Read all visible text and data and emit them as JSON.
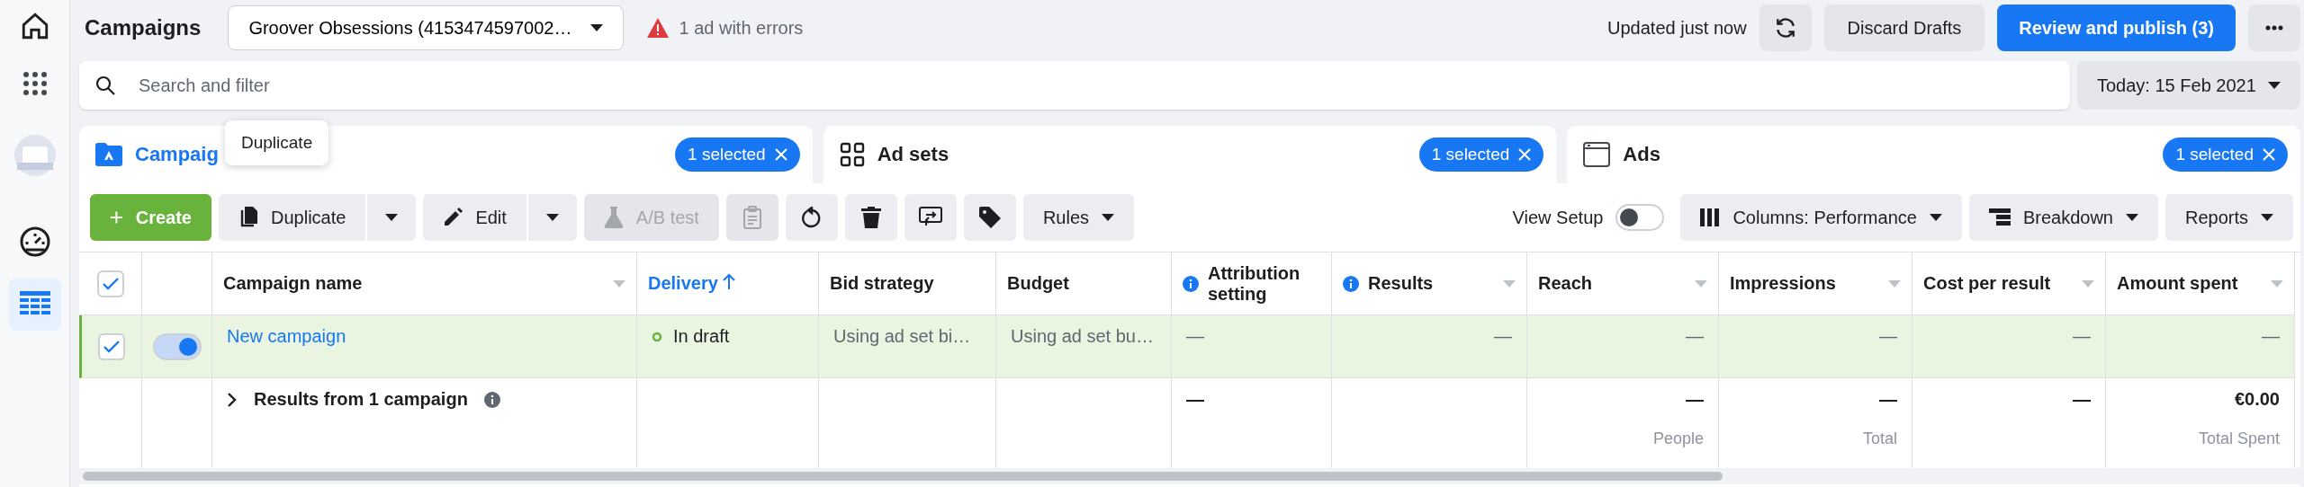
{
  "sidebar": {
    "items": [
      {
        "kind": "home",
        "selected": false
      },
      {
        "kind": "apps",
        "selected": false
      },
      {
        "kind": "avatar",
        "selected": false
      },
      {
        "kind": "gauge",
        "selected": false
      },
      {
        "kind": "table",
        "selected": true
      }
    ]
  },
  "header": {
    "title": "Campaigns",
    "account": "Groover Obsessions (4153474597002…",
    "warning": "1 ad with errors",
    "updated": "Updated just now",
    "discard": "Discard Drafts",
    "publish": "Review and publish (3)"
  },
  "search": {
    "placeholder": "Search and filter"
  },
  "date": "Today: 15 Feb 2021",
  "tabs": [
    {
      "kind": "campaigns",
      "label": "Campaig",
      "selected": true,
      "badge": "1 selected"
    },
    {
      "kind": "adsets",
      "label": "Ad sets",
      "selected": false,
      "badge": "1 selected"
    },
    {
      "kind": "ads",
      "label": "Ads",
      "selected": false,
      "badge": "1 selected"
    }
  ],
  "tooltip": "Duplicate",
  "toolbar": {
    "items": [
      {
        "kind": "create",
        "label": "Create",
        "disabled": false
      },
      {
        "kind": "split",
        "label": "Duplicate",
        "disabled": false
      },
      {
        "kind": "split",
        "label": "Edit",
        "disabled": false
      },
      {
        "kind": "button",
        "label": "A/B test",
        "disabled": true
      },
      {
        "kind": "icon",
        "disabled": true
      },
      {
        "kind": "icon",
        "disabled": false
      },
      {
        "kind": "icon",
        "disabled": false
      },
      {
        "kind": "icon",
        "disabled": false
      },
      {
        "kind": "icon",
        "disabled": false
      },
      {
        "kind": "menu",
        "label": "Rules",
        "disabled": false
      }
    ],
    "right": [
      {
        "kind": "toggle",
        "label": "View Setup",
        "on": false
      },
      {
        "kind": "menu",
        "label": "Columns: Performance"
      },
      {
        "kind": "menu",
        "label": "Breakdown"
      },
      {
        "kind": "menu",
        "label": "Reports"
      }
    ]
  },
  "table": {
    "all_checked": true,
    "columns": [
      {
        "label": "Campaign name",
        "kind": "text",
        "info": false,
        "sorted": false,
        "menu": true
      },
      {
        "label": "Delivery",
        "kind": "text",
        "info": false,
        "sorted": true,
        "menu": false
      },
      {
        "label": "Bid strategy",
        "kind": "text",
        "info": false,
        "sorted": false,
        "menu": false
      },
      {
        "label": "Budget",
        "kind": "text",
        "info": false,
        "sorted": false,
        "menu": false
      },
      {
        "label": "Attribution setting",
        "kind": "text",
        "info": true,
        "sorted": false,
        "menu": false
      },
      {
        "label": "Results",
        "kind": "metric",
        "info": true,
        "sorted": false,
        "menu": true
      },
      {
        "label": "Reach",
        "kind": "metric",
        "info": false,
        "sorted": false,
        "menu": true
      },
      {
        "label": "Impressions",
        "kind": "metric",
        "info": false,
        "sorted": false,
        "menu": true
      },
      {
        "label": "Cost per result",
        "kind": "metric",
        "info": false,
        "sorted": false,
        "menu": true
      },
      {
        "label": "Amount spent",
        "kind": "metric",
        "info": false,
        "sorted": false,
        "menu": true
      }
    ],
    "rows": [
      {
        "checked": true,
        "on": true,
        "selected": true,
        "cells": [
          "New campaign",
          "In draft",
          "Using ad set bi…",
          "Using ad set bu…",
          "—",
          "—",
          "—",
          "—",
          "—",
          "—"
        ]
      }
    ],
    "summary": {
      "label": "Results from 1 campaign",
      "cells": [
        {},
        {},
        {},
        {},
        {
          "value": "—"
        },
        {},
        {
          "value": "—",
          "sub": "People"
        },
        {
          "value": "—",
          "sub": "Total"
        },
        {
          "value": "—"
        },
        {
          "value": "€0.00",
          "sub": "Total Spent"
        }
      ]
    }
  }
}
